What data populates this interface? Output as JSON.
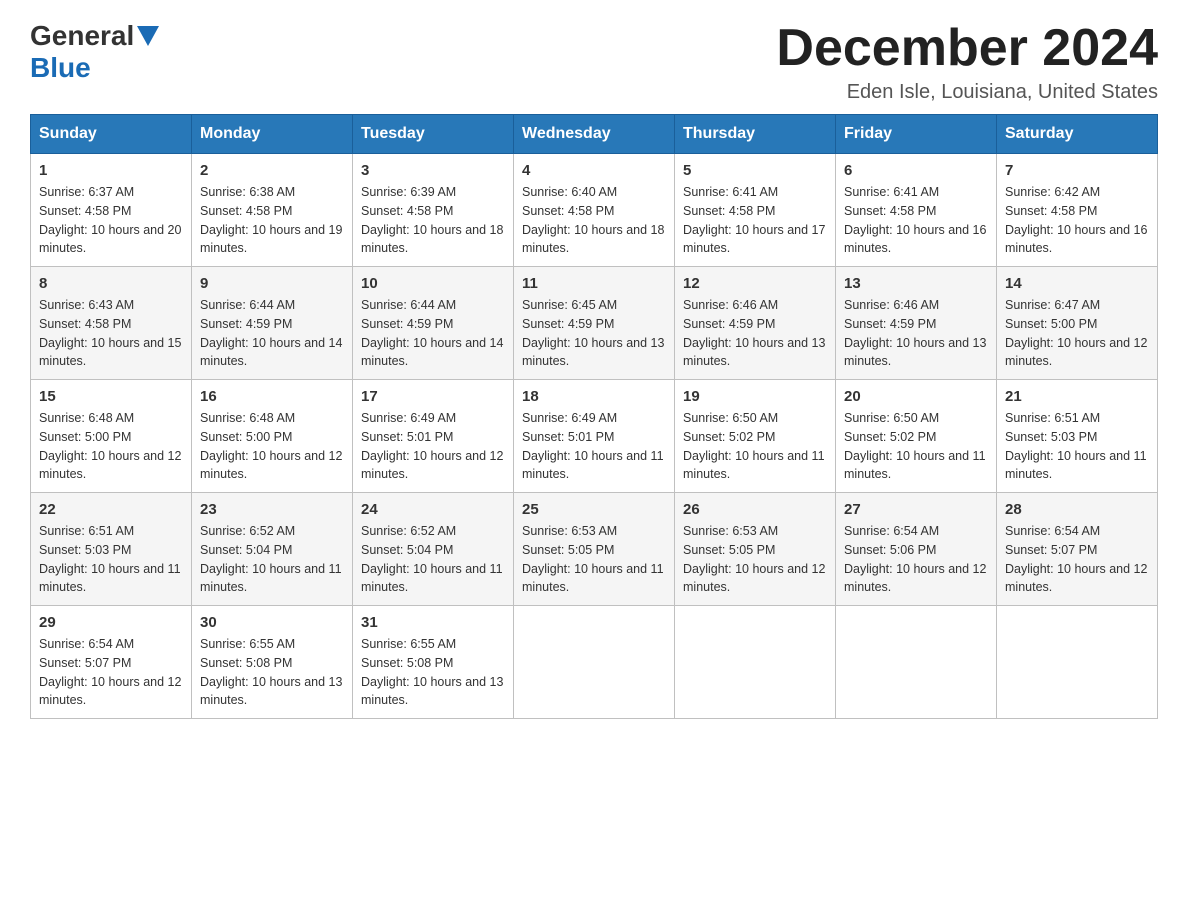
{
  "header": {
    "logo_general": "General",
    "logo_blue": "Blue",
    "month_title": "December 2024",
    "location": "Eden Isle, Louisiana, United States"
  },
  "weekdays": [
    "Sunday",
    "Monday",
    "Tuesday",
    "Wednesday",
    "Thursday",
    "Friday",
    "Saturday"
  ],
  "weeks": [
    [
      {
        "day": "1",
        "sunrise": "6:37 AM",
        "sunset": "4:58 PM",
        "daylight": "10 hours and 20 minutes."
      },
      {
        "day": "2",
        "sunrise": "6:38 AM",
        "sunset": "4:58 PM",
        "daylight": "10 hours and 19 minutes."
      },
      {
        "day": "3",
        "sunrise": "6:39 AM",
        "sunset": "4:58 PM",
        "daylight": "10 hours and 18 minutes."
      },
      {
        "day": "4",
        "sunrise": "6:40 AM",
        "sunset": "4:58 PM",
        "daylight": "10 hours and 18 minutes."
      },
      {
        "day": "5",
        "sunrise": "6:41 AM",
        "sunset": "4:58 PM",
        "daylight": "10 hours and 17 minutes."
      },
      {
        "day": "6",
        "sunrise": "6:41 AM",
        "sunset": "4:58 PM",
        "daylight": "10 hours and 16 minutes."
      },
      {
        "day": "7",
        "sunrise": "6:42 AM",
        "sunset": "4:58 PM",
        "daylight": "10 hours and 16 minutes."
      }
    ],
    [
      {
        "day": "8",
        "sunrise": "6:43 AM",
        "sunset": "4:58 PM",
        "daylight": "10 hours and 15 minutes."
      },
      {
        "day": "9",
        "sunrise": "6:44 AM",
        "sunset": "4:59 PM",
        "daylight": "10 hours and 14 minutes."
      },
      {
        "day": "10",
        "sunrise": "6:44 AM",
        "sunset": "4:59 PM",
        "daylight": "10 hours and 14 minutes."
      },
      {
        "day": "11",
        "sunrise": "6:45 AM",
        "sunset": "4:59 PM",
        "daylight": "10 hours and 13 minutes."
      },
      {
        "day": "12",
        "sunrise": "6:46 AM",
        "sunset": "4:59 PM",
        "daylight": "10 hours and 13 minutes."
      },
      {
        "day": "13",
        "sunrise": "6:46 AM",
        "sunset": "4:59 PM",
        "daylight": "10 hours and 13 minutes."
      },
      {
        "day": "14",
        "sunrise": "6:47 AM",
        "sunset": "5:00 PM",
        "daylight": "10 hours and 12 minutes."
      }
    ],
    [
      {
        "day": "15",
        "sunrise": "6:48 AM",
        "sunset": "5:00 PM",
        "daylight": "10 hours and 12 minutes."
      },
      {
        "day": "16",
        "sunrise": "6:48 AM",
        "sunset": "5:00 PM",
        "daylight": "10 hours and 12 minutes."
      },
      {
        "day": "17",
        "sunrise": "6:49 AM",
        "sunset": "5:01 PM",
        "daylight": "10 hours and 12 minutes."
      },
      {
        "day": "18",
        "sunrise": "6:49 AM",
        "sunset": "5:01 PM",
        "daylight": "10 hours and 11 minutes."
      },
      {
        "day": "19",
        "sunrise": "6:50 AM",
        "sunset": "5:02 PM",
        "daylight": "10 hours and 11 minutes."
      },
      {
        "day": "20",
        "sunrise": "6:50 AM",
        "sunset": "5:02 PM",
        "daylight": "10 hours and 11 minutes."
      },
      {
        "day": "21",
        "sunrise": "6:51 AM",
        "sunset": "5:03 PM",
        "daylight": "10 hours and 11 minutes."
      }
    ],
    [
      {
        "day": "22",
        "sunrise": "6:51 AM",
        "sunset": "5:03 PM",
        "daylight": "10 hours and 11 minutes."
      },
      {
        "day": "23",
        "sunrise": "6:52 AM",
        "sunset": "5:04 PM",
        "daylight": "10 hours and 11 minutes."
      },
      {
        "day": "24",
        "sunrise": "6:52 AM",
        "sunset": "5:04 PM",
        "daylight": "10 hours and 11 minutes."
      },
      {
        "day": "25",
        "sunrise": "6:53 AM",
        "sunset": "5:05 PM",
        "daylight": "10 hours and 11 minutes."
      },
      {
        "day": "26",
        "sunrise": "6:53 AM",
        "sunset": "5:05 PM",
        "daylight": "10 hours and 12 minutes."
      },
      {
        "day": "27",
        "sunrise": "6:54 AM",
        "sunset": "5:06 PM",
        "daylight": "10 hours and 12 minutes."
      },
      {
        "day": "28",
        "sunrise": "6:54 AM",
        "sunset": "5:07 PM",
        "daylight": "10 hours and 12 minutes."
      }
    ],
    [
      {
        "day": "29",
        "sunrise": "6:54 AM",
        "sunset": "5:07 PM",
        "daylight": "10 hours and 12 minutes."
      },
      {
        "day": "30",
        "sunrise": "6:55 AM",
        "sunset": "5:08 PM",
        "daylight": "10 hours and 13 minutes."
      },
      {
        "day": "31",
        "sunrise": "6:55 AM",
        "sunset": "5:08 PM",
        "daylight": "10 hours and 13 minutes."
      },
      null,
      null,
      null,
      null
    ]
  ],
  "labels": {
    "sunrise": "Sunrise:",
    "sunset": "Sunset:",
    "daylight": "Daylight:"
  }
}
